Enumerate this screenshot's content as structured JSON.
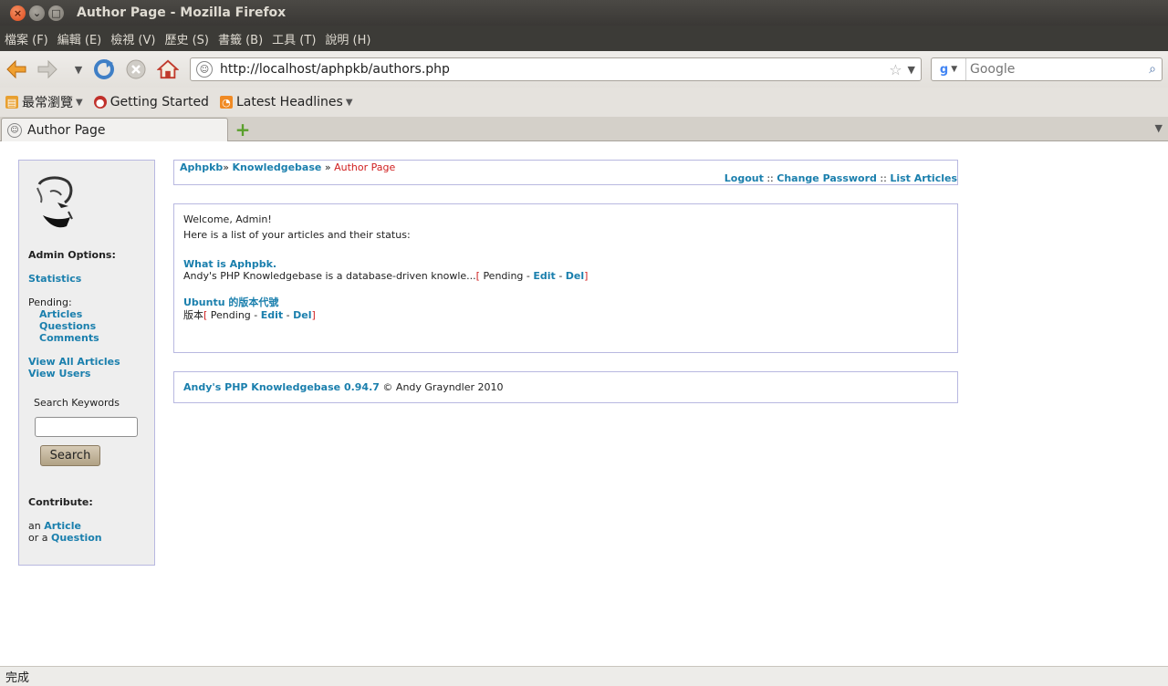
{
  "window": {
    "title": "Author Page - Mozilla Firefox"
  },
  "menu": [
    "檔案 (F)",
    "編輯 (E)",
    "檢視 (V)",
    "歷史 (S)",
    "書籤 (B)",
    "工具 (T)",
    "說明 (H)"
  ],
  "nav": {
    "url": "http://localhost/aphpkb/authors.php",
    "search_placeholder": "Google"
  },
  "bookmarks": [
    "最常瀏覽",
    "Getting Started",
    "Latest Headlines"
  ],
  "tab": {
    "title": "Author Page"
  },
  "sidebar": {
    "admin_options": "Admin Options:",
    "statistics": "Statistics",
    "pending": "Pending:",
    "articles": "Articles",
    "questions": "Questions",
    "comments": "Comments",
    "view_all_articles": "View All Articles",
    "view_users": "View Users",
    "search_keywords": "Search Keywords",
    "search_button": "Search",
    "contribute": "Contribute:",
    "an": "an",
    "article": "Article",
    "or_a": "or a",
    "question": "Question"
  },
  "breadcrumb": {
    "home": "Aphpkb",
    "sep1": "»",
    "kb": "Knowledgebase",
    "sep2": "»",
    "current": "Author Page"
  },
  "toplinks": {
    "logout": "Logout",
    "sep": "::",
    "change_password": "Change Password",
    "list_articles": "List Articles"
  },
  "main": {
    "welcome": "Welcome, Admin!",
    "intro": "Here is a list of your articles and their status:",
    "articles": [
      {
        "title": "What is Aphpbk.",
        "excerpt": "Andy's PHP Knowledgebase is a database-driven knowle...",
        "open": "[",
        "status": "Pending -",
        "edit": "Edit",
        "dash": "-",
        "del": "Del",
        "close": "]"
      },
      {
        "title": "Ubuntu 的版本代號",
        "excerpt": "版本",
        "open": "[",
        "status": "Pending -",
        "edit": "Edit",
        "dash": "-",
        "del": "Del",
        "close": "]"
      }
    ]
  },
  "footer": {
    "product": "Andy's PHP Knowledgebase 0.94.7",
    "copyright": "© Andy Grayndler 2010"
  },
  "status": {
    "text": "完成"
  }
}
